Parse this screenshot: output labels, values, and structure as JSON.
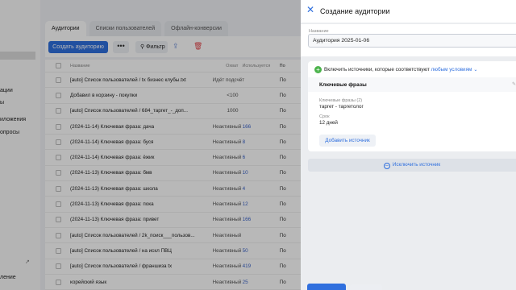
{
  "sidebar": {
    "items": [
      {
        "label": "ации"
      },
      {
        "label": "ы"
      },
      {
        "label": "иложения"
      },
      {
        "label": "опросы"
      },
      {
        "label": "ление"
      }
    ]
  },
  "tabs": [
    "Аудитории",
    "Списки пользователей",
    "Офлайн-конверсии"
  ],
  "toolbar": {
    "create_label": "Создать аудиторию",
    "more_label": "•••",
    "filter_label": "Фильтр"
  },
  "table": {
    "headers": {
      "name": "Название",
      "status": "Охват",
      "used": "Используется",
      "next": "По"
    },
    "rows": [
      {
        "name": "[auto] Список пользователей / tx бизнес клубы.txt",
        "status": "Идёт подсчёт",
        "used": "",
        "next": "По"
      },
      {
        "name": "Добавил в корзину - покупки",
        "status": "<100",
        "used": "",
        "next": "По"
      },
      {
        "name": "[auto] Список пользователей / 684_таргет_-_доп...",
        "status": "1000",
        "used": "",
        "next": "По"
      },
      {
        "name": "(2024-11-14) Ключевая фраза: дача",
        "status": "Неактивный",
        "used": "166",
        "next": "По"
      },
      {
        "name": "(2024-11-14) Ключевая фраза: буся",
        "status": "Неактивный",
        "used": "8",
        "next": "По"
      },
      {
        "name": "(2024-11-14) Ключевая фраза: ёжик",
        "status": "Неактивный",
        "used": "6",
        "next": "По"
      },
      {
        "name": "(2024-11-13) Ключевая фраза: бмв",
        "status": "Неактивный",
        "used": "10",
        "next": "По"
      },
      {
        "name": "(2024-11-13) Ключевая фраза: школа",
        "status": "Неактивный",
        "used": "4",
        "next": "По"
      },
      {
        "name": "(2024-11-13) Ключевая фраза: пока",
        "status": "Неактивный",
        "used": "12",
        "next": "По"
      },
      {
        "name": "(2024-11-13) Ключевая фраза: привет",
        "status": "Неактивный",
        "used": "166",
        "next": "По"
      },
      {
        "name": "[auto] Список пользователей / 2k_поиск___пользов...",
        "status": "Неактивный",
        "used": "",
        "next": "По"
      },
      {
        "name": "[auto] Список пользователей / на искл ПВЦ",
        "status": "Неактивный",
        "used": "50",
        "next": "По"
      },
      {
        "name": "[auto] Список пользователей / франшиза tx",
        "status": "Неактивный",
        "used": "419",
        "next": "По"
      },
      {
        "name": "корейский язык",
        "status": "Неактивный",
        "used": "25",
        "next": "По"
      }
    ]
  },
  "drawer": {
    "title": "Создание аудитории",
    "name_label": "Название",
    "name_value": "Аудитория 2025-01-06",
    "include_text": "Включить источники, которые соответствуют",
    "include_link": "любым условиям",
    "source": {
      "title": "Ключевые фразы",
      "keywords_label": "Ключевые фразы (2)",
      "keywords_value": "таргет - таргетолог",
      "term_label": "Срок",
      "term_value": "12 дней"
    },
    "add_source_label": "Добавить источник",
    "exclude_label": "Исключить источник"
  },
  "colors": {
    "accent": "#2f6fde",
    "include_icon": "#4bb34b",
    "delete_icon": "#e5484d"
  },
  "icons": [
    "close-icon",
    "plus-circle-icon",
    "chevron-down-icon",
    "minus-circle-icon",
    "filter-icon",
    "share-icon",
    "trash-icon",
    "external-link-icon",
    "edit-icon"
  ]
}
